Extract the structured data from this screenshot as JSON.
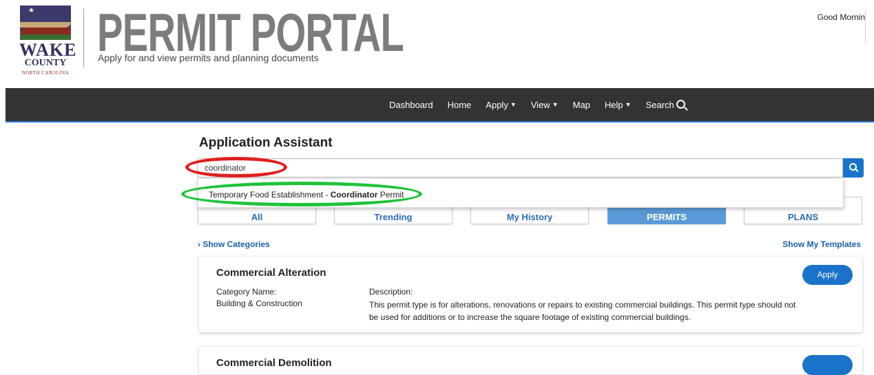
{
  "header": {
    "logo_line1": "WAKE",
    "logo_line2": "COUNTY",
    "logo_line3": "NORTH CAROLINA",
    "brand": "PERMIT PORTAL",
    "tagline": "Apply for and view permits and planning documents",
    "greeting": "Good Mornin"
  },
  "nav": {
    "items": [
      "Dashboard",
      "Home",
      "Apply",
      "View",
      "Map",
      "Help",
      "Search"
    ]
  },
  "assistant": {
    "title": "Application Assistant",
    "search_value": "coordinator",
    "suggestion_prefix": "Temporary Food Establishment - ",
    "suggestion_match": "Coordinator",
    "suggestion_suffix": " Permit",
    "categories": [
      "All",
      "Trending",
      "My History",
      "PERMITS",
      "PLANS"
    ],
    "show_categories": "Show Categories",
    "show_templates": "Show My Templates"
  },
  "permits": [
    {
      "title": "Commercial Alteration",
      "apply_label": "Apply",
      "category_label": "Category Name:",
      "category": "Building & Construction",
      "description_label": "Description:",
      "description": "This permit type is for alterations, renovations or repairs to existing commercial buildings. This permit type should not be used for additions or to increase the square footage of existing commercial buildings."
    },
    {
      "title": "Commercial Demolition"
    }
  ],
  "colors": {
    "nav_bg": "#333333",
    "accent": "#1a73c9",
    "annotation_red": "#e02020",
    "annotation_green": "#1fc23a"
  }
}
